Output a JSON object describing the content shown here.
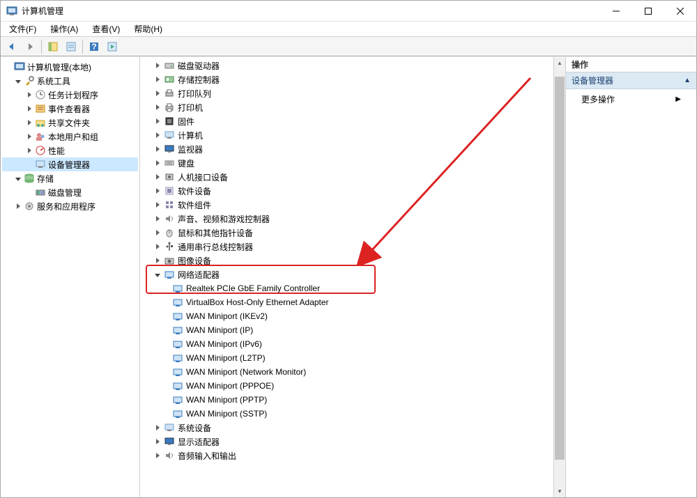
{
  "window": {
    "title": "计算机管理"
  },
  "menu": {
    "file": "文件(F)",
    "action": "操作(A)",
    "view": "查看(V)",
    "help": "帮助(H)"
  },
  "left_tree": {
    "root": "计算机管理(本地)",
    "system_tools": "系统工具",
    "task_scheduler": "任务计划程序",
    "event_viewer": "事件查看器",
    "shared_folders": "共享文件夹",
    "local_users": "本地用户和组",
    "performance": "性能",
    "device_manager": "设备管理器",
    "storage": "存储",
    "disk_mgmt": "磁盘管理",
    "services_apps": "服务和应用程序"
  },
  "devices": {
    "disk_drives": "磁盘驱动器",
    "storage_ctrl": "存储控制器",
    "print_queue": "打印队列",
    "printers": "打印机",
    "firmware": "固件",
    "computer": "计算机",
    "monitors": "监视器",
    "keyboards": "键盘",
    "hid": "人机接口设备",
    "soft_devices": "软件设备",
    "soft_components": "软件组件",
    "sound": "声音、视频和游戏控制器",
    "mice": "鼠标和其他指针设备",
    "usb": "通用串行总线控制器",
    "imaging": "图像设备",
    "network_adapters": "网络适配器",
    "na_realtek": "Realtek PCIe GbE Family Controller",
    "na_vbox": "VirtualBox Host-Only Ethernet Adapter",
    "na_ikev2": "WAN Miniport (IKEv2)",
    "na_ip": "WAN Miniport (IP)",
    "na_ipv6": "WAN Miniport (IPv6)",
    "na_l2tp": "WAN Miniport (L2TP)",
    "na_netmon": "WAN Miniport (Network Monitor)",
    "na_pppoe": "WAN Miniport (PPPOE)",
    "na_pptp": "WAN Miniport (PPTP)",
    "na_sstp": "WAN Miniport (SSTP)",
    "system_devices": "系统设备",
    "display_adapters": "显示适配器",
    "audio_io": "音频输入和输出"
  },
  "actions": {
    "header": "操作",
    "section": "设备管理器",
    "more": "更多操作"
  }
}
